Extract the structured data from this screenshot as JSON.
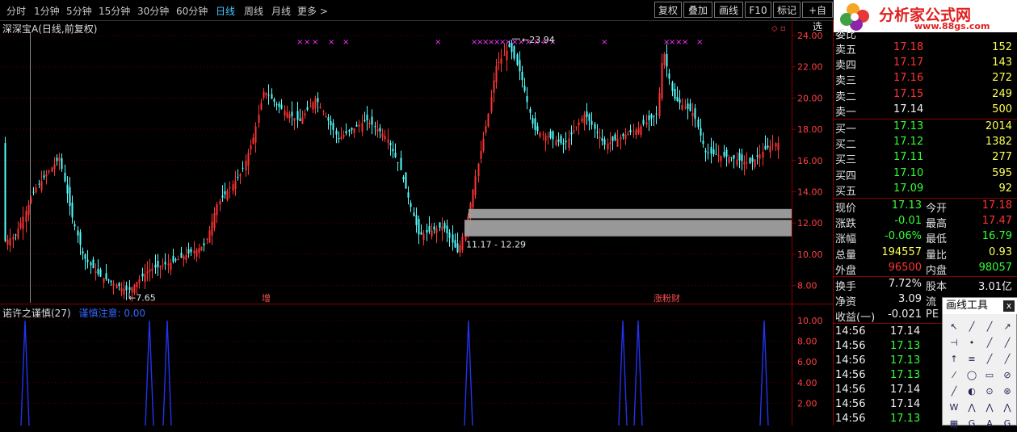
{
  "toolbar": {
    "periods": [
      "分时",
      "1分钟",
      "5分钟",
      "15分钟",
      "30分钟",
      "60分钟",
      "日线",
      "周线",
      "月线",
      "更多 >"
    ],
    "active_index": 6,
    "buttons": [
      "复权",
      "叠加",
      "画线",
      "F10",
      "标记",
      "+自选"
    ]
  },
  "logo": {
    "title": "分析家公式网",
    "url": "www.88gs.com"
  },
  "chart": {
    "title": "深深宝A(日线,前复权)",
    "y_ticks": [
      "24.00",
      "22.00",
      "20.00",
      "18.00",
      "16.00",
      "14.00",
      "12.00",
      "10.00",
      "8.00"
    ],
    "max_label": "23.94",
    "min_label": "7.65",
    "range_label": "11.17 - 12.29",
    "event_labels": [
      "增",
      "涨粉财"
    ],
    "colors": {
      "up": "#ff3333",
      "down": "#54ffff",
      "marker": "#ff33ff",
      "zone": "#a0a0a0"
    }
  },
  "indicator": {
    "name": "诺许之谨慎(27)",
    "value_label": "谨慎注意: 0.00",
    "y_ticks": [
      "10.00",
      "8.00",
      "6.00",
      "4.00",
      "2.00"
    ],
    "color": "#2233ee"
  },
  "quote": {
    "header": "委比",
    "asks": [
      {
        "label": "卖五",
        "price": "17.18",
        "vol": "152"
      },
      {
        "label": "卖四",
        "price": "17.17",
        "vol": "143"
      },
      {
        "label": "卖三",
        "price": "17.16",
        "vol": "272"
      },
      {
        "label": "卖二",
        "price": "17.15",
        "vol": "249"
      },
      {
        "label": "卖一",
        "price": "17.14",
        "vol": "500"
      }
    ],
    "bids": [
      {
        "label": "买一",
        "price": "17.13",
        "vol": "2014"
      },
      {
        "label": "买二",
        "price": "17.12",
        "vol": "1382"
      },
      {
        "label": "买三",
        "price": "17.11",
        "vol": "277"
      },
      {
        "label": "买四",
        "price": "17.10",
        "vol": "595"
      },
      {
        "label": "买五",
        "price": "17.09",
        "vol": "92"
      }
    ],
    "stats": [
      {
        "l1": "现价",
        "v1": "17.13",
        "c1": "green",
        "l2": "今开",
        "v2": "17.18",
        "c2": "red"
      },
      {
        "l1": "涨跌",
        "v1": "-0.01",
        "c1": "green",
        "l2": "最高",
        "v2": "17.47",
        "c2": "red"
      },
      {
        "l1": "涨幅",
        "v1": "-0.06%",
        "c1": "green",
        "l2": "最低",
        "v2": "16.79",
        "c2": "green"
      },
      {
        "l1": "总量",
        "v1": "194557",
        "c1": "yellow",
        "l2": "量比",
        "v2": "0.93",
        "c2": "yellow"
      },
      {
        "l1": "外盘",
        "v1": "96500",
        "c1": "red",
        "l2": "内盘",
        "v2": "98057",
        "c2": "green"
      }
    ],
    "finance": [
      {
        "l1": "换手",
        "v1": "7.72%",
        "l2": "股本",
        "v2": "3.01亿"
      },
      {
        "l1": "净资",
        "v1": "3.09",
        "l2": "流",
        "v2": ""
      },
      {
        "l1": "收益(一)",
        "v1": "-0.021",
        "l2": "PE",
        "v2": ""
      }
    ],
    "ticks": [
      {
        "time": "14:56",
        "price": "17.14",
        "color": "white"
      },
      {
        "time": "14:56",
        "price": "17.13",
        "color": "green"
      },
      {
        "time": "14:56",
        "price": "17.13",
        "color": "green"
      },
      {
        "time": "14:56",
        "price": "17.13",
        "color": "green"
      },
      {
        "time": "14:56",
        "price": "17.14",
        "color": "white"
      },
      {
        "time": "14:56",
        "price": "17.14",
        "color": "white"
      },
      {
        "time": "14:56",
        "price": "17.13",
        "color": "green"
      }
    ]
  },
  "draw_tools": {
    "title": "画线工具",
    "close": "x"
  }
}
